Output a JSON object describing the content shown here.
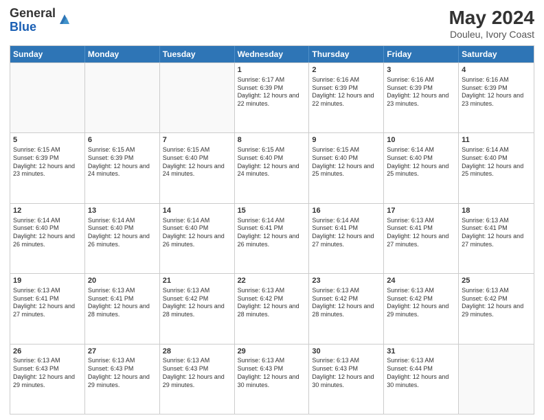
{
  "logo": {
    "general": "General",
    "blue": "Blue"
  },
  "header": {
    "title": "May 2024",
    "subtitle": "Douleu, Ivory Coast"
  },
  "weekdays": [
    "Sunday",
    "Monday",
    "Tuesday",
    "Wednesday",
    "Thursday",
    "Friday",
    "Saturday"
  ],
  "weeks": [
    [
      {
        "day": "",
        "sunrise": "",
        "sunset": "",
        "daylight": ""
      },
      {
        "day": "",
        "sunrise": "",
        "sunset": "",
        "daylight": ""
      },
      {
        "day": "",
        "sunrise": "",
        "sunset": "",
        "daylight": ""
      },
      {
        "day": "1",
        "sunrise": "Sunrise: 6:17 AM",
        "sunset": "Sunset: 6:39 PM",
        "daylight": "Daylight: 12 hours and 22 minutes."
      },
      {
        "day": "2",
        "sunrise": "Sunrise: 6:16 AM",
        "sunset": "Sunset: 6:39 PM",
        "daylight": "Daylight: 12 hours and 22 minutes."
      },
      {
        "day": "3",
        "sunrise": "Sunrise: 6:16 AM",
        "sunset": "Sunset: 6:39 PM",
        "daylight": "Daylight: 12 hours and 23 minutes."
      },
      {
        "day": "4",
        "sunrise": "Sunrise: 6:16 AM",
        "sunset": "Sunset: 6:39 PM",
        "daylight": "Daylight: 12 hours and 23 minutes."
      }
    ],
    [
      {
        "day": "5",
        "sunrise": "Sunrise: 6:15 AM",
        "sunset": "Sunset: 6:39 PM",
        "daylight": "Daylight: 12 hours and 23 minutes."
      },
      {
        "day": "6",
        "sunrise": "Sunrise: 6:15 AM",
        "sunset": "Sunset: 6:39 PM",
        "daylight": "Daylight: 12 hours and 24 minutes."
      },
      {
        "day": "7",
        "sunrise": "Sunrise: 6:15 AM",
        "sunset": "Sunset: 6:40 PM",
        "daylight": "Daylight: 12 hours and 24 minutes."
      },
      {
        "day": "8",
        "sunrise": "Sunrise: 6:15 AM",
        "sunset": "Sunset: 6:40 PM",
        "daylight": "Daylight: 12 hours and 24 minutes."
      },
      {
        "day": "9",
        "sunrise": "Sunrise: 6:15 AM",
        "sunset": "Sunset: 6:40 PM",
        "daylight": "Daylight: 12 hours and 25 minutes."
      },
      {
        "day": "10",
        "sunrise": "Sunrise: 6:14 AM",
        "sunset": "Sunset: 6:40 PM",
        "daylight": "Daylight: 12 hours and 25 minutes."
      },
      {
        "day": "11",
        "sunrise": "Sunrise: 6:14 AM",
        "sunset": "Sunset: 6:40 PM",
        "daylight": "Daylight: 12 hours and 25 minutes."
      }
    ],
    [
      {
        "day": "12",
        "sunrise": "Sunrise: 6:14 AM",
        "sunset": "Sunset: 6:40 PM",
        "daylight": "Daylight: 12 hours and 26 minutes."
      },
      {
        "day": "13",
        "sunrise": "Sunrise: 6:14 AM",
        "sunset": "Sunset: 6:40 PM",
        "daylight": "Daylight: 12 hours and 26 minutes."
      },
      {
        "day": "14",
        "sunrise": "Sunrise: 6:14 AM",
        "sunset": "Sunset: 6:40 PM",
        "daylight": "Daylight: 12 hours and 26 minutes."
      },
      {
        "day": "15",
        "sunrise": "Sunrise: 6:14 AM",
        "sunset": "Sunset: 6:41 PM",
        "daylight": "Daylight: 12 hours and 26 minutes."
      },
      {
        "day": "16",
        "sunrise": "Sunrise: 6:14 AM",
        "sunset": "Sunset: 6:41 PM",
        "daylight": "Daylight: 12 hours and 27 minutes."
      },
      {
        "day": "17",
        "sunrise": "Sunrise: 6:13 AM",
        "sunset": "Sunset: 6:41 PM",
        "daylight": "Daylight: 12 hours and 27 minutes."
      },
      {
        "day": "18",
        "sunrise": "Sunrise: 6:13 AM",
        "sunset": "Sunset: 6:41 PM",
        "daylight": "Daylight: 12 hours and 27 minutes."
      }
    ],
    [
      {
        "day": "19",
        "sunrise": "Sunrise: 6:13 AM",
        "sunset": "Sunset: 6:41 PM",
        "daylight": "Daylight: 12 hours and 27 minutes."
      },
      {
        "day": "20",
        "sunrise": "Sunrise: 6:13 AM",
        "sunset": "Sunset: 6:41 PM",
        "daylight": "Daylight: 12 hours and 28 minutes."
      },
      {
        "day": "21",
        "sunrise": "Sunrise: 6:13 AM",
        "sunset": "Sunset: 6:42 PM",
        "daylight": "Daylight: 12 hours and 28 minutes."
      },
      {
        "day": "22",
        "sunrise": "Sunrise: 6:13 AM",
        "sunset": "Sunset: 6:42 PM",
        "daylight": "Daylight: 12 hours and 28 minutes."
      },
      {
        "day": "23",
        "sunrise": "Sunrise: 6:13 AM",
        "sunset": "Sunset: 6:42 PM",
        "daylight": "Daylight: 12 hours and 28 minutes."
      },
      {
        "day": "24",
        "sunrise": "Sunrise: 6:13 AM",
        "sunset": "Sunset: 6:42 PM",
        "daylight": "Daylight: 12 hours and 29 minutes."
      },
      {
        "day": "25",
        "sunrise": "Sunrise: 6:13 AM",
        "sunset": "Sunset: 6:42 PM",
        "daylight": "Daylight: 12 hours and 29 minutes."
      }
    ],
    [
      {
        "day": "26",
        "sunrise": "Sunrise: 6:13 AM",
        "sunset": "Sunset: 6:43 PM",
        "daylight": "Daylight: 12 hours and 29 minutes."
      },
      {
        "day": "27",
        "sunrise": "Sunrise: 6:13 AM",
        "sunset": "Sunset: 6:43 PM",
        "daylight": "Daylight: 12 hours and 29 minutes."
      },
      {
        "day": "28",
        "sunrise": "Sunrise: 6:13 AM",
        "sunset": "Sunset: 6:43 PM",
        "daylight": "Daylight: 12 hours and 29 minutes."
      },
      {
        "day": "29",
        "sunrise": "Sunrise: 6:13 AM",
        "sunset": "Sunset: 6:43 PM",
        "daylight": "Daylight: 12 hours and 30 minutes."
      },
      {
        "day": "30",
        "sunrise": "Sunrise: 6:13 AM",
        "sunset": "Sunset: 6:43 PM",
        "daylight": "Daylight: 12 hours and 30 minutes."
      },
      {
        "day": "31",
        "sunrise": "Sunrise: 6:13 AM",
        "sunset": "Sunset: 6:44 PM",
        "daylight": "Daylight: 12 hours and 30 minutes."
      },
      {
        "day": "",
        "sunrise": "",
        "sunset": "",
        "daylight": ""
      }
    ]
  ]
}
